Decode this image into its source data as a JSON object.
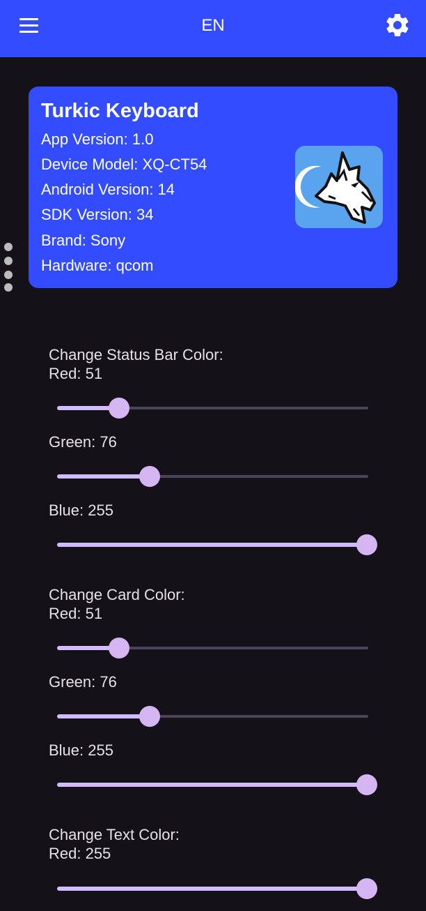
{
  "toolbar": {
    "menu_icon": "hamburger-menu-icon",
    "language": "EN",
    "settings_icon": "gear-icon",
    "background_color": "#334cff"
  },
  "side_handle_icon": "vertical-dots-icon",
  "info_card": {
    "title": "Turkic Keyboard",
    "lines": [
      "App Version: 1.0",
      "Device Model: XQ-CT54",
      "Android Version: 14",
      "SDK Version: 34",
      "Brand: Sony",
      "Hardware: qcom"
    ],
    "app_icon": "white-wolf-head-logo",
    "card_color": "#334cff"
  },
  "color_sections": [
    {
      "title": "Change Status Bar Color:",
      "sliders": [
        {
          "label": "Red: 51",
          "value": 51,
          "max": 255
        },
        {
          "label": "Green: 76",
          "value": 76,
          "max": 255
        },
        {
          "label": "Blue: 255",
          "value": 255,
          "max": 255
        }
      ]
    },
    {
      "title": "Change Card Color:",
      "sliders": [
        {
          "label": "Red: 51",
          "value": 51,
          "max": 255
        },
        {
          "label": "Green: 76",
          "value": 76,
          "max": 255
        },
        {
          "label": "Blue: 255",
          "value": 255,
          "max": 255
        }
      ]
    },
    {
      "title": "Change Text Color:",
      "sliders": [
        {
          "label": "Red: 255",
          "value": 255,
          "max": 255
        }
      ]
    }
  ],
  "theme": {
    "background": "#141218",
    "slider_active": "#d0bcff",
    "slider_inactive": "#4a4458",
    "text": "#e6e0e9"
  }
}
